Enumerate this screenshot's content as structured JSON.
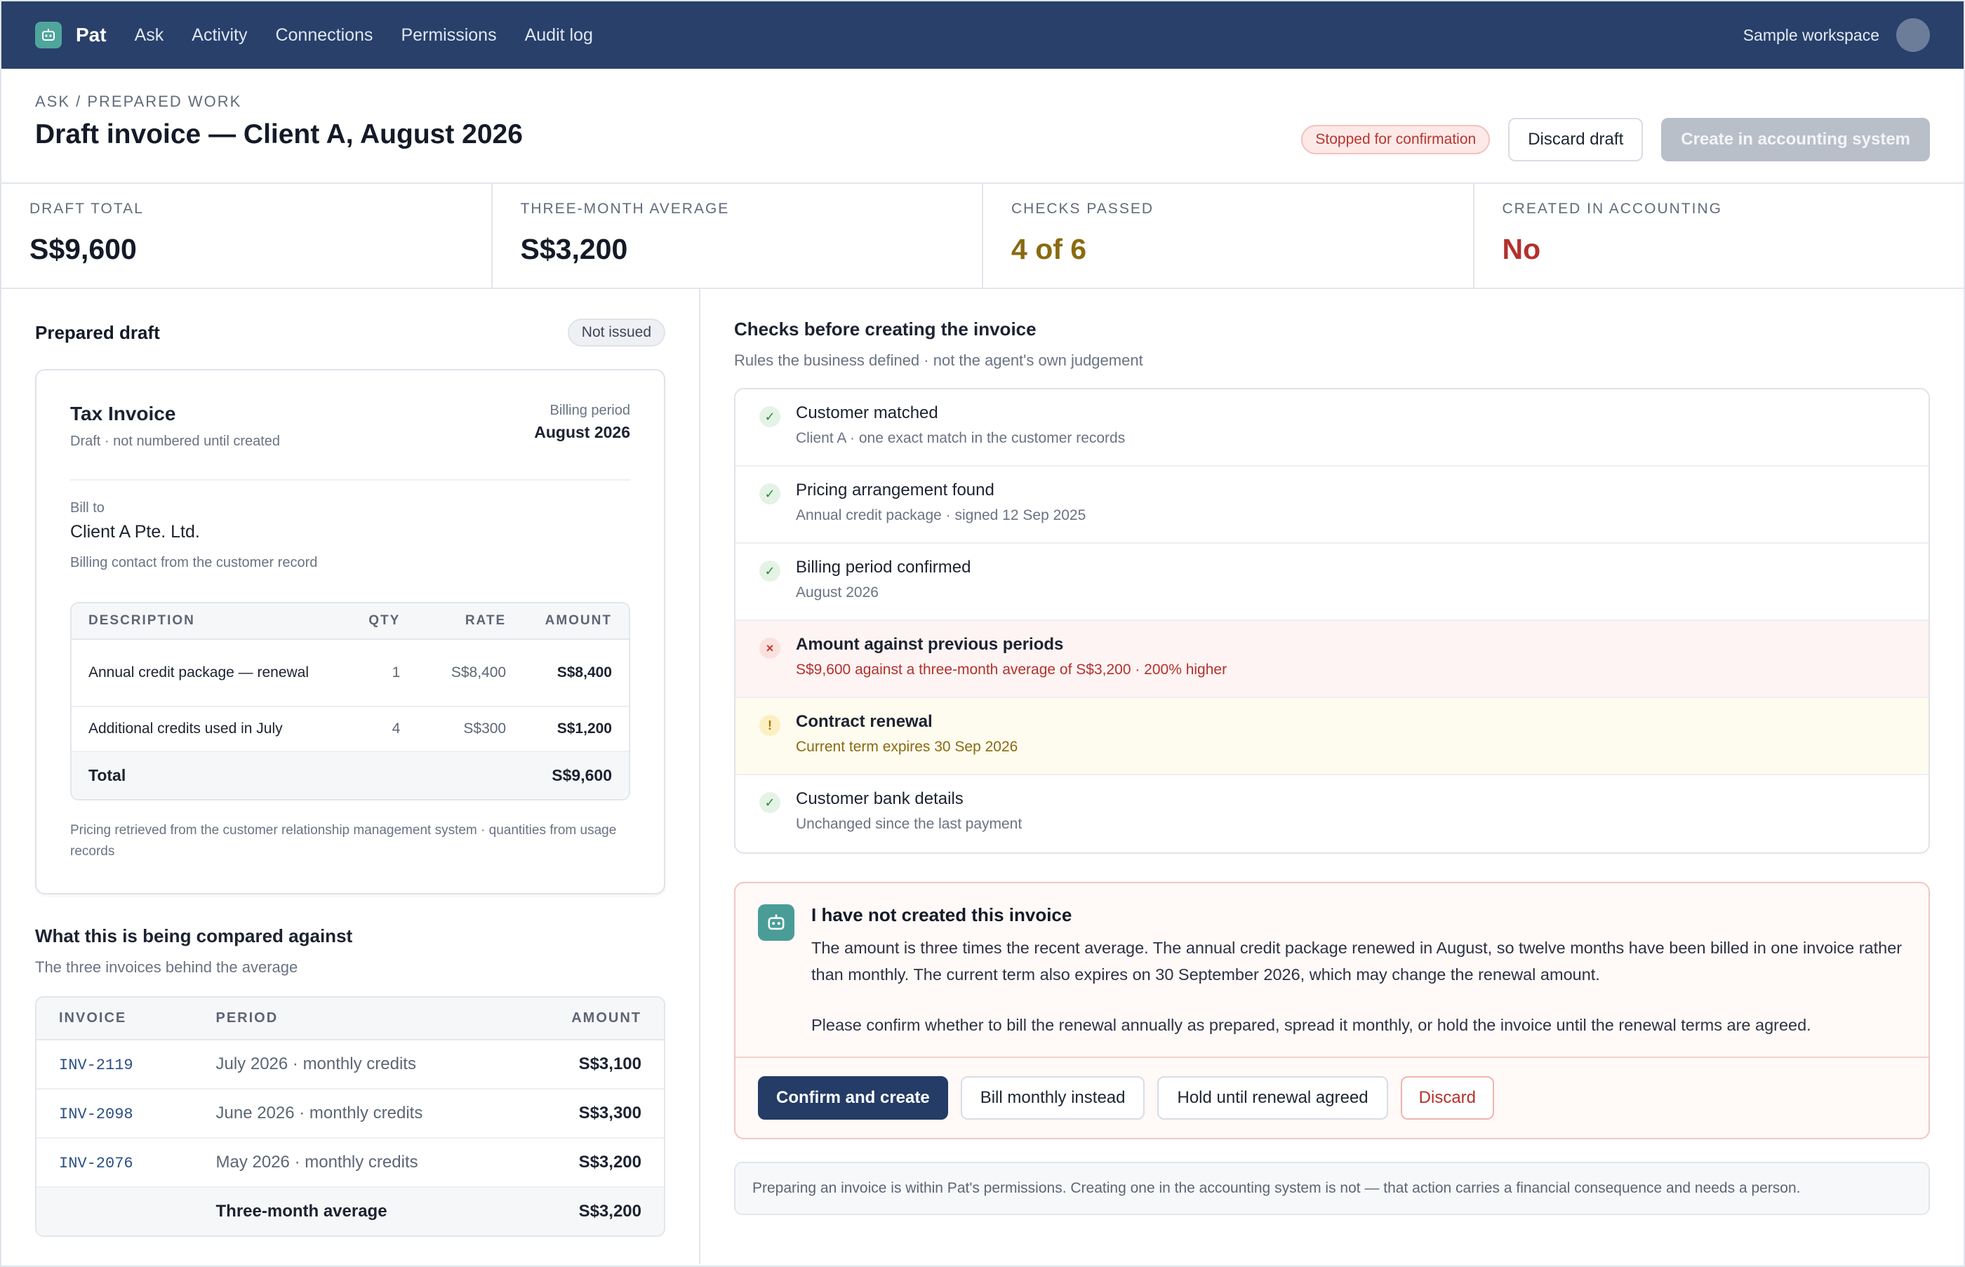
{
  "topbar": {
    "brand": "Pat",
    "nav": [
      "Ask",
      "Activity",
      "Connections",
      "Permissions",
      "Audit log"
    ],
    "workspace": "Sample workspace"
  },
  "header": {
    "breadcrumb": "ASK / PREPARED WORK",
    "title": "Draft invoice — Client A, August 2026",
    "status": "Stopped for confirmation",
    "discard_label": "Discard draft",
    "create_label": "Create in accounting system"
  },
  "stats": [
    {
      "label": "DRAFT TOTAL",
      "value": "S$9,600"
    },
    {
      "label": "THREE-MONTH AVERAGE",
      "value": "S$3,200"
    },
    {
      "label": "CHECKS PASSED",
      "value": "4 of 6"
    },
    {
      "label": "CREATED IN ACCOUNTING",
      "value": "No"
    }
  ],
  "draft": {
    "title": "Prepared draft",
    "badge": "Not issued",
    "invoice": {
      "title": "Tax Invoice",
      "subtitle": "Draft · not numbered until created",
      "period_label": "Billing period",
      "period": "August 2026",
      "bill_to_label": "Bill to",
      "bill_to_name": "Client A Pte. Ltd.",
      "bill_to_note": "Billing contact from the customer record",
      "columns": [
        "DESCRIPTION",
        "QTY",
        "RATE",
        "AMOUNT"
      ],
      "lines": [
        {
          "description": "Annual credit package — renewal",
          "qty": "1",
          "rate": "S$8,400",
          "amount": "S$8,400"
        },
        {
          "description": "Additional credits used in July",
          "qty": "4",
          "rate": "S$300",
          "amount": "S$1,200"
        }
      ],
      "total_label": "Total",
      "total": "S$9,600",
      "footnote": "Pricing retrieved from the customer relationship management system · quantities from usage records"
    }
  },
  "comparison": {
    "title": "What this is being compared against",
    "subtitle": "The three invoices behind the average",
    "columns": [
      "INVOICE",
      "PERIOD",
      "AMOUNT"
    ],
    "rows": [
      {
        "invoice": "INV-2119",
        "period": "July 2026 · monthly credits",
        "amount": "S$3,100"
      },
      {
        "invoice": "INV-2098",
        "period": "June 2026 · monthly credits",
        "amount": "S$3,300"
      },
      {
        "invoice": "INV-2076",
        "period": "May 2026 · monthly credits",
        "amount": "S$3,200"
      }
    ],
    "average_label": "Three-month average",
    "average": "S$3,200"
  },
  "checks": {
    "title": "Checks before creating the invoice",
    "subtitle": "Rules the business defined · not the agent's own judgement",
    "items": [
      {
        "status": "ok",
        "icon": "check-icon",
        "title": "Customer matched",
        "detail": "Client A · one exact match in the customer records"
      },
      {
        "status": "ok",
        "icon": "check-icon",
        "title": "Pricing arrangement found",
        "detail": "Annual credit package · signed 12 Sep 2025"
      },
      {
        "status": "ok",
        "icon": "check-icon",
        "title": "Billing period confirmed",
        "detail": "August 2026"
      },
      {
        "status": "fail",
        "icon": "cross-icon",
        "title": "Amount against previous periods",
        "detail": "S$9,600 against a three-month average of S$3,200 · 200% higher"
      },
      {
        "status": "warn",
        "icon": "exclamation-icon",
        "title": "Contract renewal",
        "detail": "Current term expires 30 Sep 2026"
      },
      {
        "status": "ok",
        "icon": "check-icon",
        "title": "Customer bank details",
        "detail": "Unchanged since the last payment"
      }
    ]
  },
  "agent_message": {
    "title": "I have not created this invoice",
    "paragraph1": "The amount is three times the recent average. The annual credit package renewed in August, so twelve months have been billed in one invoice rather than monthly. The current term also expires on 30 September 2026, which may change the renewal amount.",
    "paragraph2": "Please confirm whether to bill the renewal annually as prepared, spread it monthly, or hold the invoice until the renewal terms are agreed.",
    "actions": {
      "confirm": "Confirm and create",
      "monthly": "Bill monthly instead",
      "hold": "Hold until renewal agreed",
      "discard": "Discard"
    }
  },
  "permission_note": "Preparing an invoice is within Pat's permissions. Creating one in the accounting system is not — that action carries a financial consequence and needs a person.",
  "colors": {
    "navy": "#28406a",
    "teal": "#4fa59c",
    "danger": "#b3312c",
    "warning": "#8a6a10",
    "success": "#2b8a3e"
  }
}
